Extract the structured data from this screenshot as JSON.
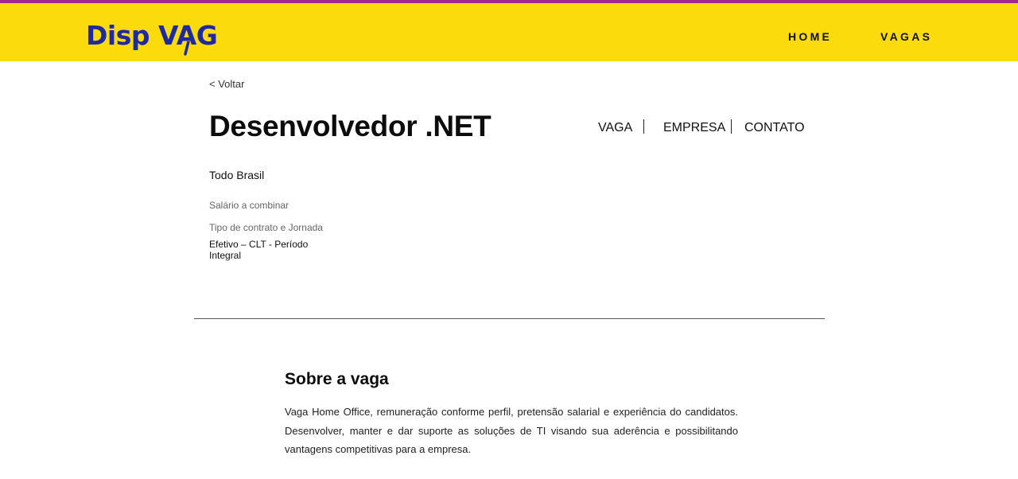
{
  "header": {
    "logo_text": "Disp VAG",
    "nav": {
      "home": "HOME",
      "vagas": "VAGAS"
    }
  },
  "job": {
    "back_label": "< Voltar",
    "title": "Desenvolvedor .NET",
    "tabs": {
      "vaga": "VAGA",
      "empresa": "EMPRESA",
      "contato": "CONTATO"
    },
    "location": "Todo Brasil",
    "salary": "Salário a combinar",
    "contract_label": "Tipo de contrato e Jornada",
    "contract_value": "Efetivo – CLT - Período Integral"
  },
  "about": {
    "title": "Sobre a vaga",
    "text": "Vaga Home Office, remuneração conforme perfil, pretensão salarial e experiência do candidatos. Desenvolver, manter e dar suporte as soluções de TI visando sua aderência e possibilitando vantagens competitivas para a empresa."
  },
  "colors": {
    "header_bg": "#fcdb0d",
    "logo": "#1f2aa0",
    "top_line": "#a02a8c"
  }
}
